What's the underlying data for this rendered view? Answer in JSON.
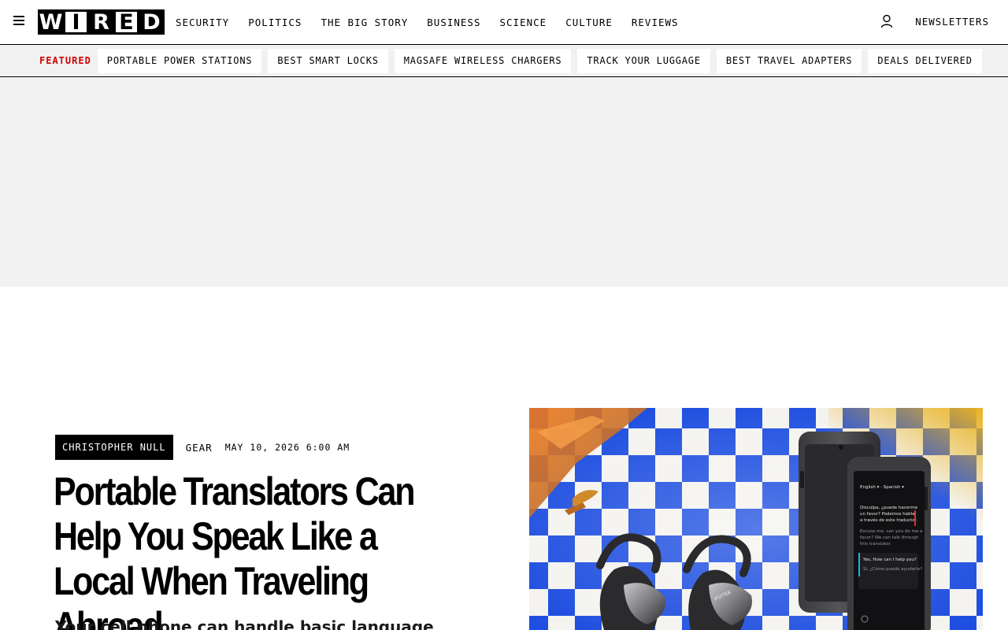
{
  "header": {
    "logo_letters": [
      "W",
      "I",
      "R",
      "E",
      "D"
    ],
    "nav": [
      "SECURITY",
      "POLITICS",
      "THE BIG STORY",
      "BUSINESS",
      "SCIENCE",
      "CULTURE",
      "REVIEWS"
    ],
    "newsletters_label": "NEWSLETTERS"
  },
  "featured": {
    "label": "FEATURED",
    "items": [
      "PORTABLE POWER STATIONS",
      "BEST SMART LOCKS",
      "MAGSAFE WIRELESS CHARGERS",
      "TRACK YOUR LUGGAGE",
      "BEST TRAVEL ADAPTERS",
      "DEALS DELIVERED"
    ]
  },
  "article": {
    "author": "CHRISTOPHER NULL",
    "category": "GEAR",
    "date": "MAY 10, 2026 6:00 AM",
    "headline": "Portable Translators Can Help You Speak Like a Local When Traveling Abroad",
    "dek": "Your cell phone can handle basic language"
  },
  "hero": {
    "device_brand": "IFLYTEK",
    "screen_lines": [
      "Disculpa, ¿puede hacerme un favor? ¿Podemos hablar a través de este traductor.",
      "Excuse me, can you do me a favor? We can talk through this translator.",
      "Yes, How can I help you?",
      "Sí, ¿Cómo puedo ayudarle?"
    ]
  }
}
